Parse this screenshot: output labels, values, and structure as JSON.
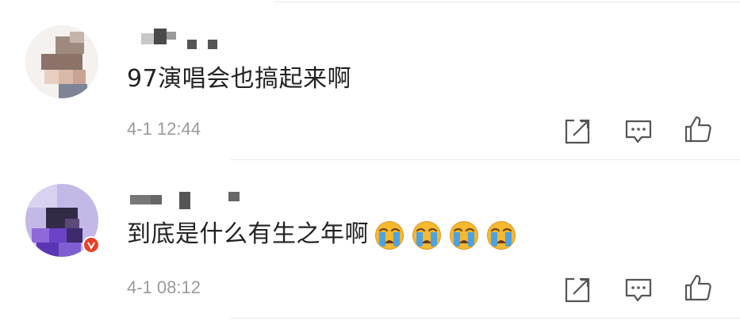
{
  "comments": [
    {
      "text": "97演唱会也搞起来啊",
      "time": "4-1 12:44",
      "actions": [
        "share-icon",
        "comment-icon",
        "like-icon"
      ]
    },
    {
      "text": "到底是什么有生之年啊",
      "time": "4-1 08:12",
      "emojis": [
        "crying-face-icon",
        "crying-face-icon",
        "crying-face-icon",
        "crying-face-icon"
      ],
      "actions": [
        "share-icon",
        "comment-icon",
        "like-icon"
      ]
    }
  ],
  "colors": {
    "text": "#222222",
    "meta": "#9a9a9a",
    "divider": "#ececec",
    "icon": "#555555",
    "emoji_face": "#f5b82e",
    "emoji_tear": "#4ba3e3",
    "badge": "#e8412b"
  }
}
